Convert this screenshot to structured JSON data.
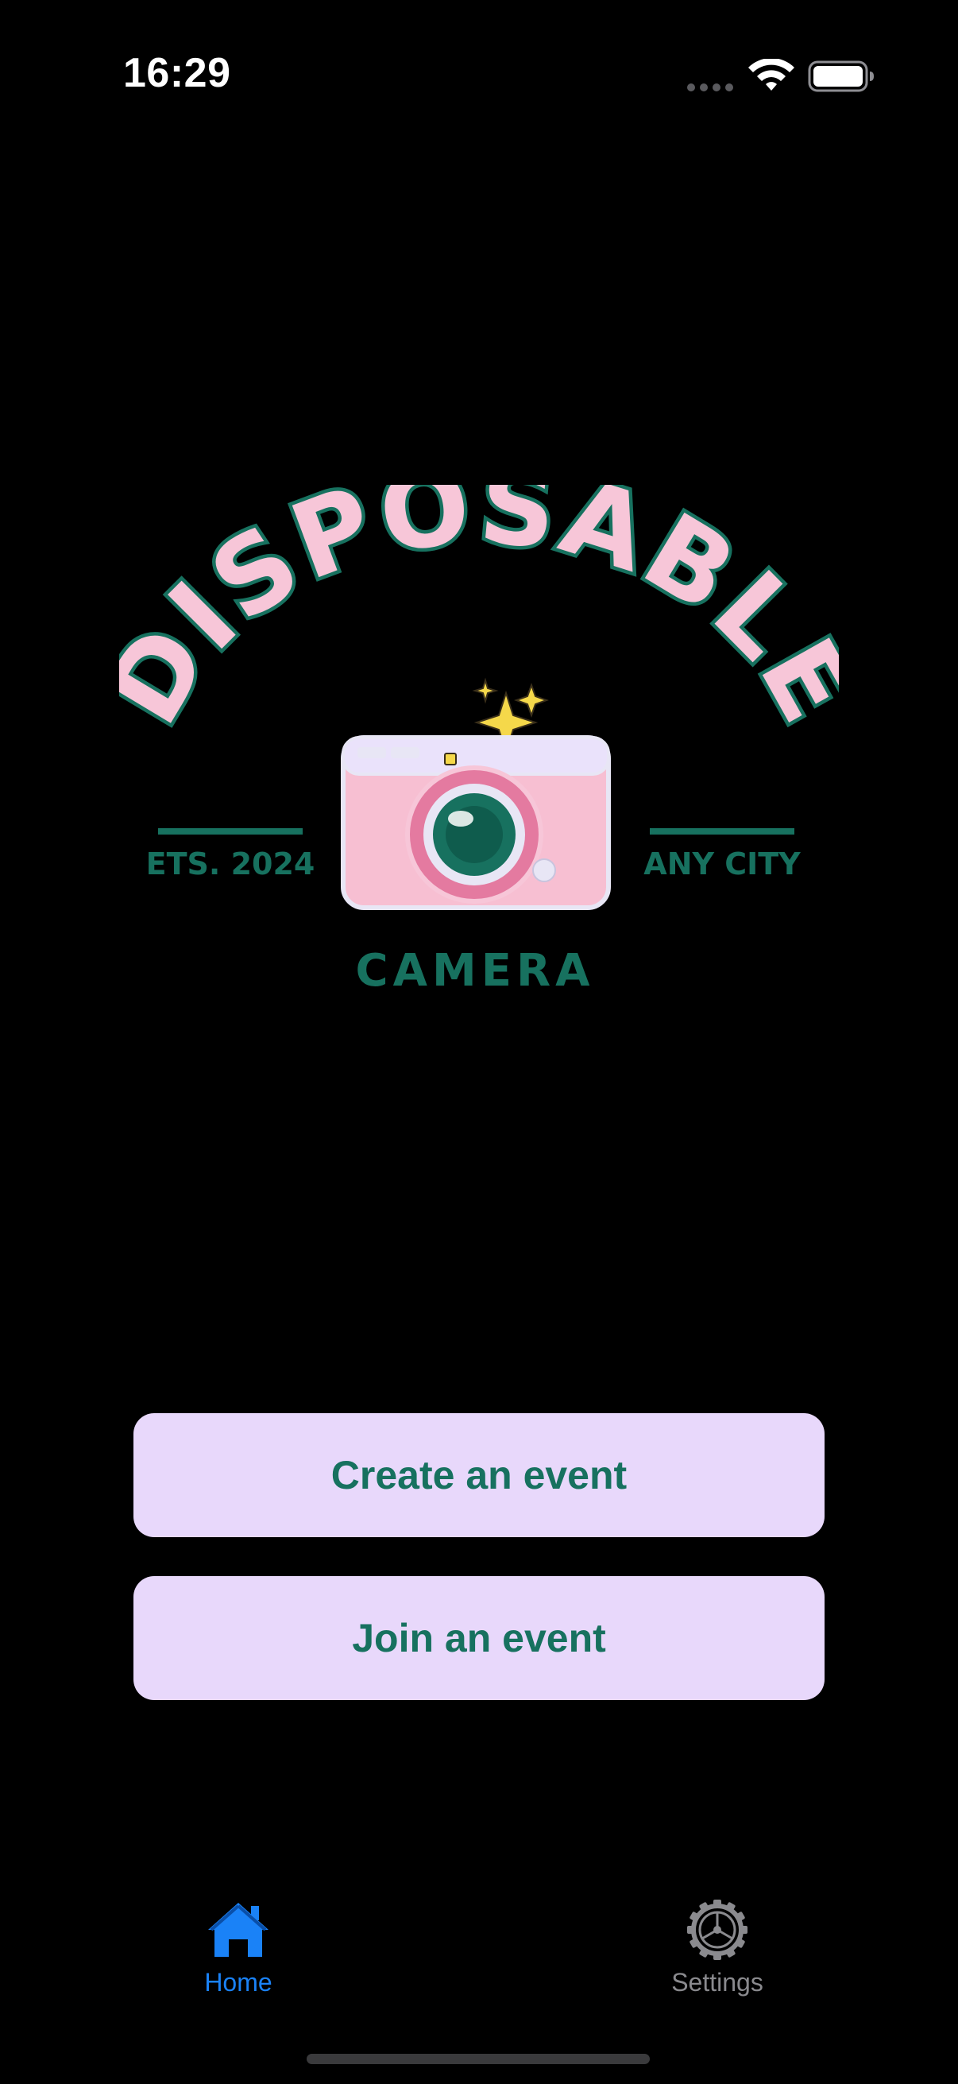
{
  "status_bar": {
    "time": "16:29",
    "signal_icon": "cellular-signal-icon",
    "wifi_icon": "wifi-icon",
    "battery_icon": "battery-icon"
  },
  "logo": {
    "icon": "disposable-camera-logo",
    "title": "DISPOSABLE",
    "subtitle": "CAMERA",
    "left_tag": "ETS. 2024",
    "right_tag": "ANY CITY",
    "colors": {
      "pink": "#f7c6d8",
      "teal": "#17715f",
      "yellow": "#f5d84a"
    }
  },
  "actions": {
    "create_label": "Create an event",
    "join_label": "Join an event"
  },
  "tab_bar": {
    "tabs": [
      {
        "label": "Home",
        "icon": "house-icon",
        "selected": true
      },
      {
        "label": "Settings",
        "icon": "gear-icon",
        "selected": false
      }
    ],
    "active_color": "#1a82f7",
    "inactive_color": "#8a8a8e"
  },
  "theme": {
    "background": "#000000",
    "button_background": "#e8d8fb",
    "button_text": "#17715f"
  }
}
